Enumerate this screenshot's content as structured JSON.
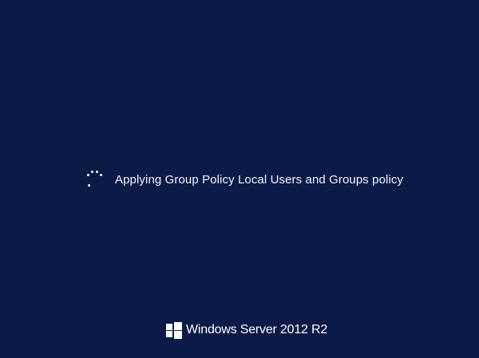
{
  "screen": {
    "background_color": "#0c1a48",
    "status_message": "Applying Group Policy Local Users and Groups policy",
    "spinner_icon": "loading-spinner-icon"
  },
  "branding": {
    "logo_icon": "windows-logo-icon",
    "product_name": "Windows Server 2012 R2"
  }
}
